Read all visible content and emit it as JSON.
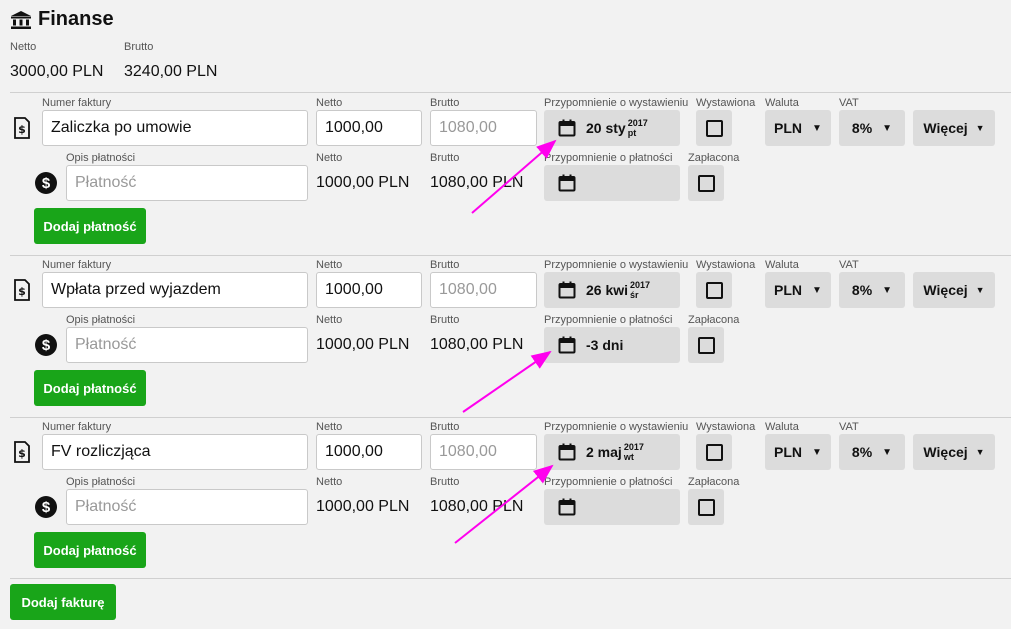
{
  "header": {
    "title": "Finanse",
    "netto_label": "Netto",
    "netto_value": "3000,00 PLN",
    "brutto_label": "Brutto",
    "brutto_value": "3240,00 PLN"
  },
  "labels": {
    "invoice_number": "Numer faktury",
    "netto": "Netto",
    "brutto": "Brutto",
    "reminder_issue": "Przypomnienie o wystawieniu",
    "issued": "Wystawiona",
    "currency": "Waluta",
    "vat": "VAT",
    "payment_desc": "Opis płatności",
    "reminder_payment": "Przypomnienie o płatności",
    "paid": "Zapłacona"
  },
  "invoices": [
    {
      "number": "Zaliczka po umowie",
      "netto": "1000,00",
      "brutto_placeholder": "1080,00",
      "issue_date": {
        "day": "20 sty",
        "year": "2017",
        "weekday": "pt"
      },
      "currency": "PLN",
      "vat": "8%",
      "more": "Więcej",
      "payment_placeholder": "Płatność",
      "payment_netto": "1000,00 PLN",
      "payment_brutto": "1080,00 PLN",
      "payment_reminder": "",
      "add_payment": "Dodaj płatność"
    },
    {
      "number": "Wpłata przed wyjazdem",
      "netto": "1000,00",
      "brutto_placeholder": "1080,00",
      "issue_date": {
        "day": "26 kwi",
        "year": "2017",
        "weekday": "śr"
      },
      "currency": "PLN",
      "vat": "8%",
      "more": "Więcej",
      "payment_placeholder": "Płatność",
      "payment_netto": "1000,00 PLN",
      "payment_brutto": "1080,00 PLN",
      "payment_reminder": "-3 dni",
      "add_payment": "Dodaj płatność"
    },
    {
      "number": "FV rozliczjąca",
      "netto": "1000,00",
      "brutto_placeholder": "1080,00",
      "issue_date": {
        "day": "2 maj",
        "year": "2017",
        "weekday": "wt"
      },
      "currency": "PLN",
      "vat": "8%",
      "more": "Więcej",
      "payment_placeholder": "Płatność",
      "payment_netto": "1000,00 PLN",
      "payment_brutto": "1080,00 PLN",
      "payment_reminder": "",
      "add_payment": "Dodaj płatność"
    }
  ],
  "add_invoice_label": "Dodaj fakturę",
  "colors": {
    "accent_green": "#19a519",
    "annotation_arrow": "#ff00ee"
  },
  "icons": [
    "bank-icon",
    "invoice-dollar-icon",
    "dollar-circle-icon",
    "calendar-icon",
    "caret-down-icon"
  ]
}
